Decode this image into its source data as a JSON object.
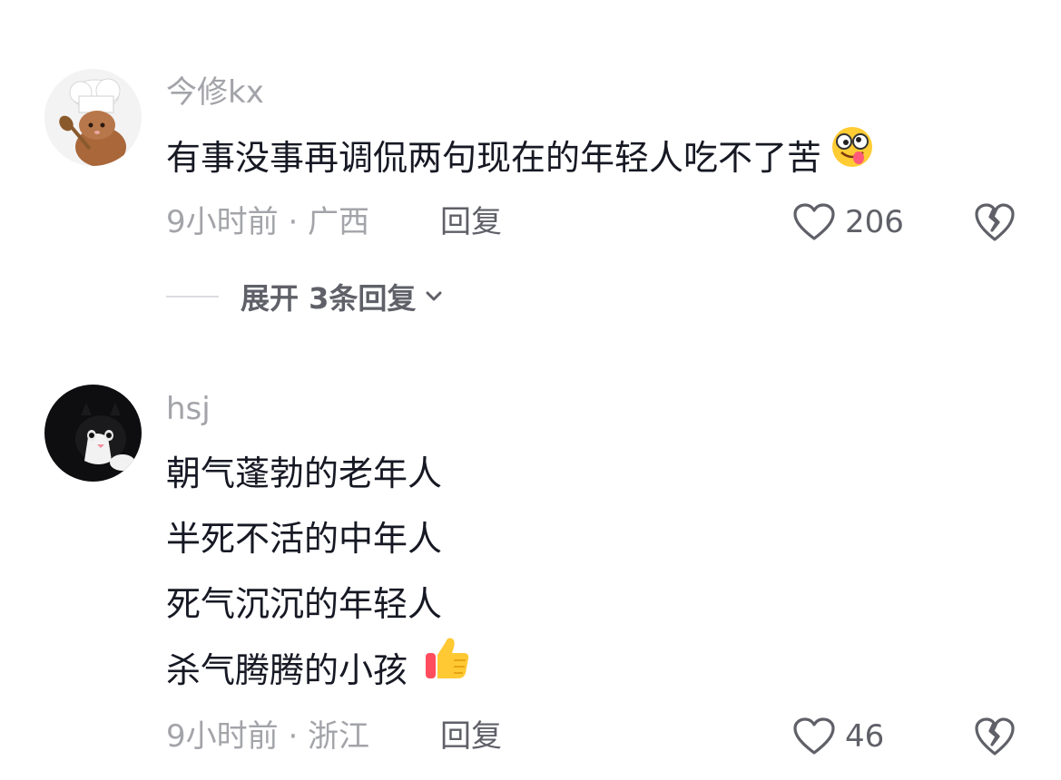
{
  "comments": [
    {
      "username": "今修kx",
      "avatar": "chef-cat-avatar",
      "lines": [
        "有事没事再调侃两句现在的年轻人吃不了苦"
      ],
      "trailing_emoji": "silly-face-emoji",
      "time_location": "9小时前 · 广西",
      "reply_label": "回复",
      "like_count": "206",
      "expand_label": "展开 3条回复"
    },
    {
      "username": "hsj",
      "avatar": "tuxedo-cat-avatar",
      "lines": [
        "朝气蓬勃的老年人",
        "半死不活的中年人",
        "死气沉沉的年轻人",
        "杀气腾腾的小孩"
      ],
      "trailing_emoji": "thumbs-up-emoji",
      "time_location": "9小时前 · 浙江",
      "reply_label": "回复",
      "like_count": "46"
    }
  ],
  "icons": {
    "like": "heart-outline-icon",
    "dislike": "broken-heart-icon",
    "expand": "chevron-down-icon"
  },
  "colors": {
    "primary_text": "#161823",
    "secondary_text": "#a3a4a9",
    "action_text": "#5f6068"
  }
}
